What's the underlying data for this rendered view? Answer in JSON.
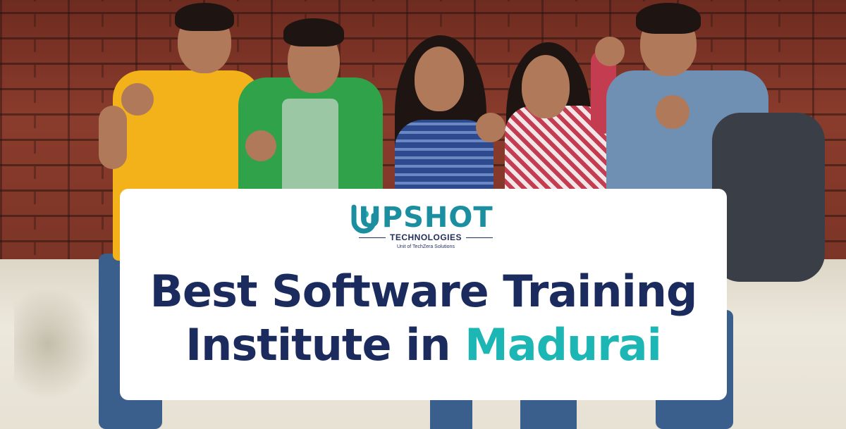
{
  "logo": {
    "brand": "UPSHOT",
    "subtitle": "TECHNOLOGIES",
    "unit_line": "Unit of TechZera Solutions",
    "colors": {
      "primary": "#1b8fa0",
      "secondary": "#1f2e5a"
    }
  },
  "headline": {
    "line1": "Best Software Training",
    "line2_prefix": "Institute in ",
    "line2_accent": "Madurai"
  },
  "colors": {
    "headline": "#1b2b5e",
    "accent": "#1cb6b4",
    "card": "#ffffff"
  },
  "photo": {
    "subject": "five smiling students raising fists against a brick wall"
  }
}
